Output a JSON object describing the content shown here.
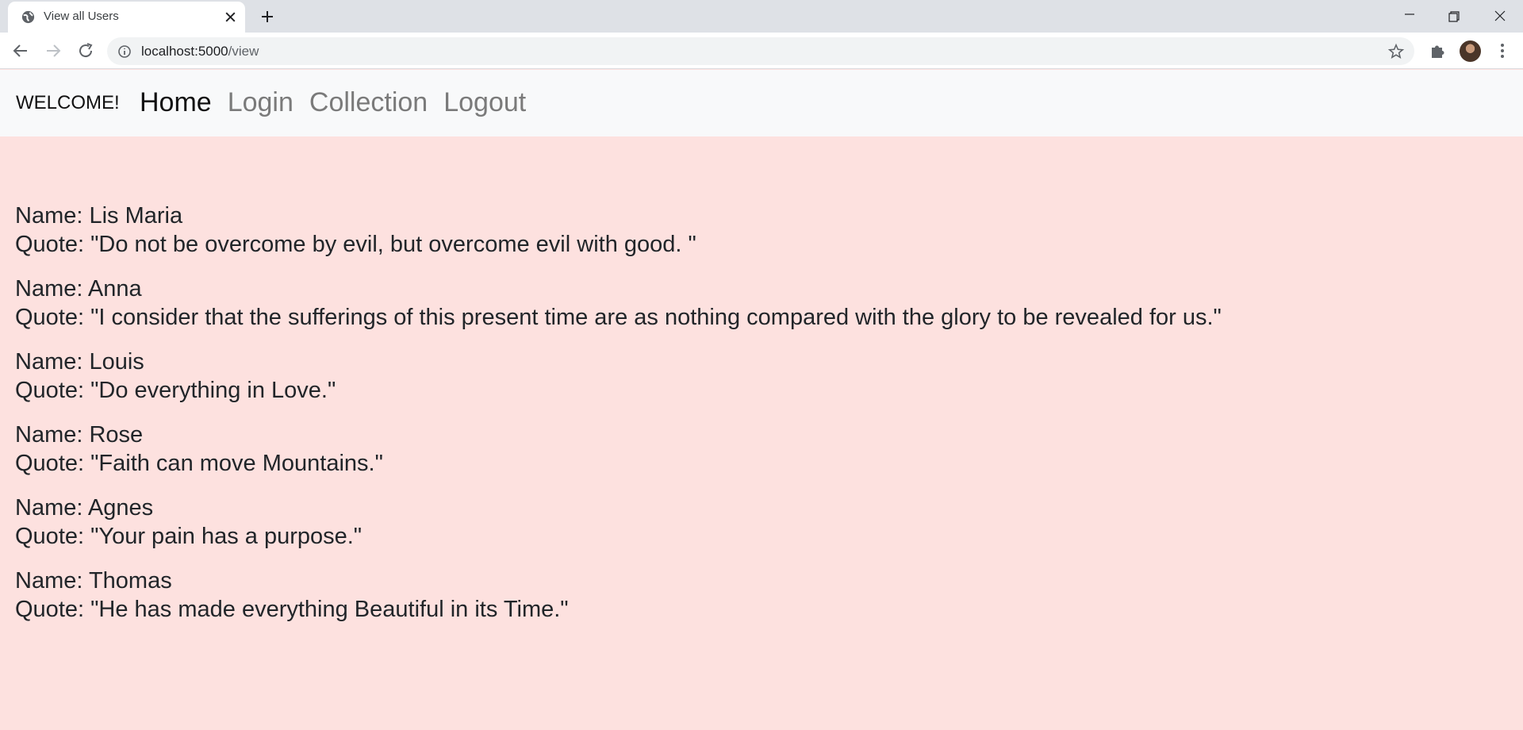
{
  "browser": {
    "tab_title": "View all Users",
    "url_host": "localhost:5000",
    "url_path": "/view"
  },
  "navbar": {
    "brand": "WELCOME!",
    "links": [
      {
        "label": "Home",
        "active": true
      },
      {
        "label": "Login",
        "active": false
      },
      {
        "label": "Collection",
        "active": false
      },
      {
        "label": "Logout",
        "active": false
      }
    ]
  },
  "users": [
    {
      "name": "Name: Lis Maria",
      "quote": "Quote: \"Do not be overcome by evil, but overcome evil with good. \""
    },
    {
      "name": "Name: Anna",
      "quote": "Quote: \"I consider that the sufferings of this present time are as nothing compared with the glory to be revealed for us.\""
    },
    {
      "name": "Name: Louis",
      "quote": "Quote: \"Do everything in Love.\""
    },
    {
      "name": "Name: Rose",
      "quote": "Quote: \"Faith can move Mountains.\""
    },
    {
      "name": "Name: Agnes",
      "quote": "Quote: \"Your pain has a purpose.\""
    },
    {
      "name": "Name: Thomas",
      "quote": "Quote: \"He has made everything Beautiful in its Time.\""
    }
  ],
  "colors": {
    "page_background": "#fde1df",
    "navbar_background": "#f8f9fa",
    "active_link": "#111111",
    "inactive_link": "#7a7a7a"
  },
  "icons": [
    "globe-icon",
    "close-icon",
    "plus-icon",
    "minimize-icon",
    "restore-icon",
    "window-close-icon",
    "back-arrow-icon",
    "forward-arrow-icon",
    "reload-icon",
    "info-icon",
    "star-icon",
    "puzzle-icon",
    "kebab-menu-icon"
  ]
}
